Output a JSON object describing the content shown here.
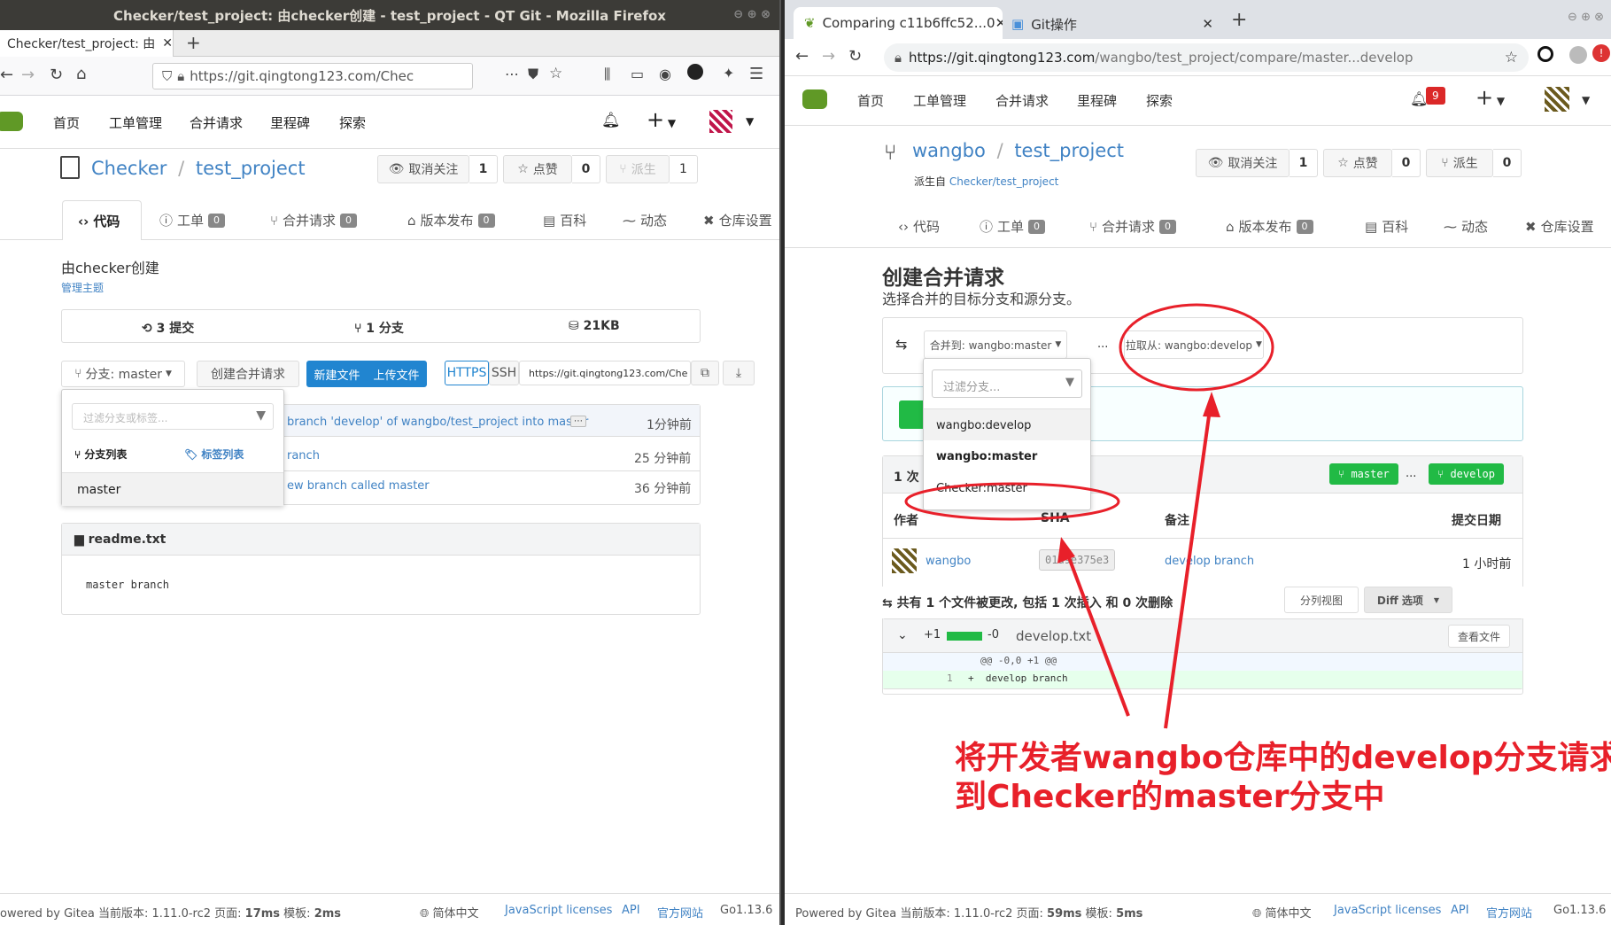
{
  "left": {
    "window_title": "Checker/test_project: 由checker创建 - test_project - QT Git - Mozilla Firefox",
    "tab_title": "Checker/test_project: 由",
    "url": "https://git.qingtong123.com/Chec",
    "nav": {
      "home": "首页",
      "issues": "工单管理",
      "pulls": "合并请求",
      "milestones": "里程碑",
      "explore": "探索",
      "plus": "+"
    },
    "repo": {
      "owner": "Checker",
      "sep": "/",
      "name": "test_project"
    },
    "actions": {
      "unwatch": "取消关注",
      "unwatch_count": "1",
      "star": "点赞",
      "star_count": "0",
      "fork": "派生",
      "fork_count": "1"
    },
    "tabs": {
      "code": "代码",
      "issues": "工单",
      "issues_count": "0",
      "pulls": "合并请求",
      "pulls_count": "0",
      "releases": "版本发布",
      "releases_count": "0",
      "wiki": "百科",
      "activity": "动态",
      "settings": "仓库设置"
    },
    "desc": "由checker创建",
    "manage_topics": "管理主题",
    "stats": {
      "commits": "3 提交",
      "branches": "1 分支",
      "size": "21KB"
    },
    "branch_btn": "分支: master",
    "create_pr": "创建合并请求",
    "new_file": "新建文件",
    "upload_file": "上传文件",
    "https": "HTTPS",
    "ssh": "SSH",
    "clone_url": "https://git.qingtong123.com/Che",
    "dropdown": {
      "placeholder": "过滤分支或标签...",
      "branch_list": "分支列表",
      "tag_list": "标签列表",
      "item": "master"
    },
    "commits": [
      {
        "msg": "branch 'develop' of wangbo/test_project into master",
        "time": "1分钟前"
      },
      {
        "msg": "ranch",
        "time": "25 分钟前"
      },
      {
        "msg": "ew branch called master",
        "time": "36 分钟前"
      }
    ],
    "readme": {
      "title": "readme.txt",
      "content": "master branch"
    },
    "footer": {
      "powered": "owered by Gitea 当前版本: 1.11.0-rc2 页面: ",
      "page_time": "17ms",
      "tmpl_label": " 模板: ",
      "tmpl_time": "2ms",
      "lang": "简体中文",
      "licenses": "JavaScript licenses",
      "api": "API",
      "site": "官方网站",
      "go": "Go1.13.6"
    }
  },
  "right": {
    "tabs": [
      {
        "title": "Comparing c11b6ffc52...0"
      },
      {
        "title": "Git操作"
      }
    ],
    "url_prefix": "https://git.qingtong123.com",
    "url_rest": "/wangbo/test_project/compare/master...develop",
    "notif_count": "9",
    "nav": {
      "home": "首页",
      "issues": "工单管理",
      "pulls": "合并请求",
      "milestones": "里程碑",
      "explore": "探索",
      "plus": "+"
    },
    "repo": {
      "owner": "wangbo",
      "sep": "/",
      "name": "test_project",
      "forked_from_label": "派生自 ",
      "forked_from": "Checker/test_project"
    },
    "actions": {
      "unwatch": "取消关注",
      "unwatch_count": "1",
      "star": "点赞",
      "star_count": "0",
      "fork": "派生",
      "fork_count": "0"
    },
    "tabs_repo": {
      "code": "代码",
      "issues": "工单",
      "issues_count": "0",
      "pulls": "合并请求",
      "pulls_count": "0",
      "releases": "版本发布",
      "releases_count": "0",
      "wiki": "百科",
      "activity": "动态",
      "settings": "仓库设置"
    },
    "compare": {
      "title": "创建合并请求",
      "subtitle": "选择合并的目标分支和源分支。",
      "base": "合并到: wangbo:master",
      "ellipsis": "...",
      "head": "拉取从: wangbo:develop"
    },
    "dropdown": {
      "placeholder": "过滤分支...",
      "items": [
        "wangbo:develop",
        "wangbo:master",
        "Checker:master"
      ]
    },
    "commits_head": {
      "count": "1 次",
      "master": "master",
      "dots": "...",
      "develop": "develop"
    },
    "table": {
      "author": "作者",
      "sha": "SHA",
      "message": "备注",
      "date": "提交日期"
    },
    "commit": {
      "author": "wangbo",
      "sha": "01a9e375e3",
      "msg": "develop branch",
      "time": "1 小时前"
    },
    "diffstat": "共有 1 个文件被更改, 包括 1 次插入 和 0 次删除",
    "split_view": "分列视图",
    "diff_options": "Diff 选项",
    "file": {
      "add": "+1",
      "del": "-0",
      "name": "develop.txt",
      "view": "查看文件",
      "hunk": "@@ -0,0 +1 @@",
      "line_no": "1",
      "line": "+  develop branch"
    },
    "annotation": [
      "将开发者wangbo仓库中的develop分支请求合并",
      "到Checker的master分支中"
    ],
    "footer": {
      "powered": "Powered by Gitea 当前版本: 1.11.0-rc2 页面: ",
      "page_time": "59ms",
      "tmpl_label": " 模板: ",
      "tmpl_time": "5ms",
      "lang": "简体中文",
      "licenses": "JavaScript licenses",
      "api": "API",
      "site": "官方网站",
      "go": "Go1.13.6"
    }
  },
  "colors": {
    "accent": "#4183c4",
    "green": "#21ba45",
    "annotation_red": "#e8202a",
    "notif": "#db2828"
  }
}
